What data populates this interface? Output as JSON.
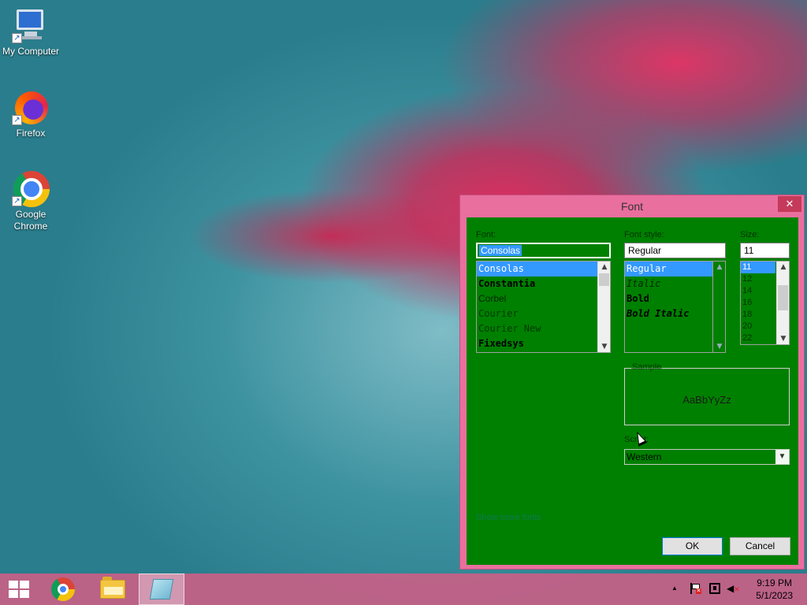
{
  "desktop": {
    "icons": [
      {
        "label": "My Computer",
        "icon": "computer-icon"
      },
      {
        "label": "Firefox",
        "icon": "firefox-icon"
      },
      {
        "label": "Google Chrome",
        "icon": "chrome-icon"
      }
    ]
  },
  "dialog": {
    "title": "Font",
    "close_glyph": "✕",
    "font_label": "Font:",
    "font_value": "Consolas",
    "font_list": [
      "Consolas",
      "Constantia",
      "Corbel",
      "Courier",
      "Courier New",
      "Fixedsys"
    ],
    "style_label": "Font style:",
    "style_value": "Regular",
    "style_list": [
      "Regular",
      "Italic",
      "Bold",
      "Bold Italic"
    ],
    "size_label": "Size:",
    "size_value": "11",
    "size_list": [
      "11",
      "12",
      "14",
      "16",
      "18",
      "20",
      "22"
    ],
    "sample_label": "Sample",
    "sample_text": "AaBbYyZz",
    "script_label": "Script:",
    "script_value": "Western",
    "more_fonts_link": "Show more fonts",
    "ok_label": "OK",
    "cancel_label": "Cancel"
  },
  "taskbar": {
    "apps": [
      {
        "name": "start",
        "icon": "windows-logo-icon"
      },
      {
        "name": "chrome",
        "icon": "chrome-icon"
      },
      {
        "name": "file-explorer",
        "icon": "folder-icon"
      },
      {
        "name": "notepad",
        "icon": "notepad-icon",
        "active": true
      }
    ],
    "tray": {
      "chevron": "▲",
      "time": "9:19 PM",
      "date": "5/1/2023"
    }
  },
  "colors": {
    "dialog_frame": "#e96f9e",
    "dialog_client": "#008000",
    "selection": "#3399ff",
    "taskbar": "#c85f87"
  }
}
